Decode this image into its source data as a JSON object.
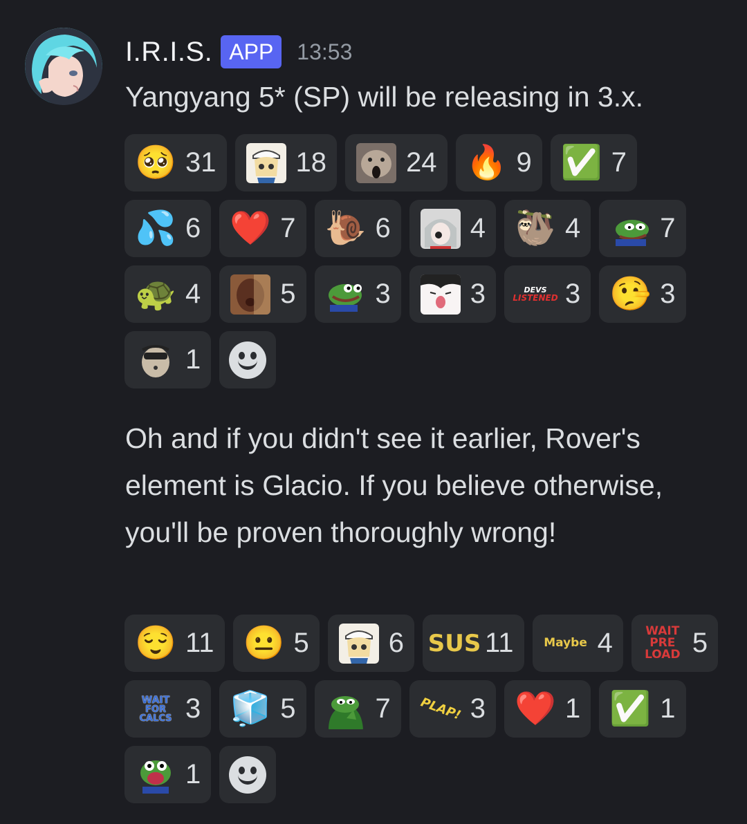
{
  "message": {
    "author": "I.R.I.S.",
    "badge": "APP",
    "timestamp": "13:53",
    "text1": "Yangyang 5* (SP) will be releasing in 3.x.",
    "text2": "Oh and if you didn't see it earlier, Rover's element is Glacio. If you believe otherwise, you'll be proven thoroughly wrong!"
  },
  "reactions1": [
    {
      "icon": "pleading-face-icon",
      "glyph": "🥺",
      "count": "31"
    },
    {
      "icon": "anime-girl-sticker-icon",
      "glyph": "",
      "count": "18"
    },
    {
      "icon": "hamster-scream-icon",
      "glyph": "",
      "count": "24"
    },
    {
      "icon": "fire-icon",
      "glyph": "🔥",
      "count": "9"
    },
    {
      "icon": "check-mark-icon",
      "glyph": "✅",
      "count": "7"
    },
    {
      "icon": "sweat-drops-icon",
      "glyph": "💦",
      "count": "6"
    },
    {
      "icon": "heart-icon",
      "glyph": "❤️",
      "count": "7"
    },
    {
      "icon": "snail-icon",
      "glyph": "🐌",
      "count": "6"
    },
    {
      "icon": "anime-crying-icon",
      "glyph": "",
      "count": "4"
    },
    {
      "icon": "sloth-icon",
      "glyph": "🦥",
      "count": "4"
    },
    {
      "icon": "pepe-icon",
      "glyph": "",
      "count": "7"
    },
    {
      "icon": "turtle-icon",
      "glyph": "🐢",
      "count": "4"
    },
    {
      "icon": "man-kiss-icon",
      "glyph": "",
      "count": "5"
    },
    {
      "icon": "pepe-happy-icon",
      "glyph": "",
      "count": "3"
    },
    {
      "icon": "anime-shocked-icon",
      "glyph": "",
      "count": "3"
    },
    {
      "icon": "devs-listened-icon",
      "text_lines": [
        "DEVS",
        "LISTENED"
      ],
      "count": "3"
    },
    {
      "icon": "lying-face-icon",
      "glyph": "🤥",
      "count": "3"
    },
    {
      "icon": "hamster-shades-icon",
      "glyph": "",
      "count": "1"
    }
  ],
  "reactions2": [
    {
      "icon": "relieved-smirk-icon",
      "glyph": "😌",
      "count": "11"
    },
    {
      "icon": "neutral-face-icon",
      "glyph": "😐",
      "count": "5"
    },
    {
      "icon": "anime-girl-sticker-icon",
      "glyph": "",
      "count": "6"
    },
    {
      "icon": "sus-text-icon",
      "text_lines": [
        "SUS"
      ],
      "count": "11"
    },
    {
      "icon": "maybe-text-icon",
      "text_lines": [
        "Maybe"
      ],
      "count": "4"
    },
    {
      "icon": "wait-preload-icon",
      "text_lines": [
        "WAIT",
        "PRE",
        "LOAD"
      ],
      "count": "5"
    },
    {
      "icon": "wait-for-calcs-icon",
      "text_lines": [
        "WAIT",
        "FOR",
        "CALCS"
      ],
      "count": "3"
    },
    {
      "icon": "ice-cube-icon",
      "glyph": "🧊",
      "count": "5"
    },
    {
      "icon": "pepe-thumbs-up-icon",
      "glyph": "",
      "count": "7"
    },
    {
      "icon": "plap-text-icon",
      "text_lines": [
        "PLAP!"
      ],
      "count": "3"
    },
    {
      "icon": "heart-icon",
      "glyph": "❤️",
      "count": "1"
    },
    {
      "icon": "check-mark-icon",
      "glyph": "✅",
      "count": "1"
    },
    {
      "icon": "pepe-shouting-icon",
      "glyph": "",
      "count": "1"
    }
  ],
  "colors": {
    "background": "#1c1d22",
    "reaction_bg": "#2b2d31",
    "badge": "#5865f2",
    "text": "#dbdee1",
    "muted": "#949ba4"
  }
}
